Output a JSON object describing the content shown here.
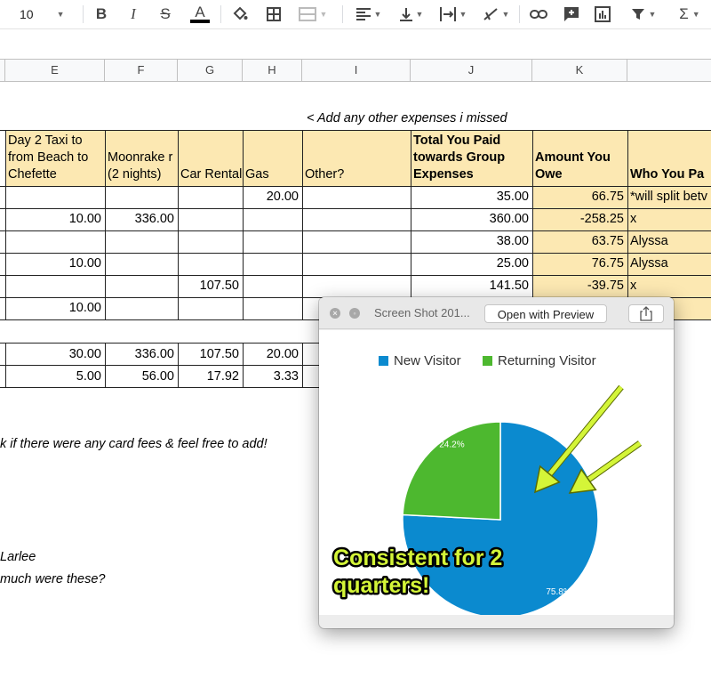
{
  "toolbar": {
    "font_size": "10",
    "bold_label": "B",
    "italic_label": "I",
    "strike_label": "S",
    "text_color_label": "A",
    "sum_label": "Σ"
  },
  "columns": [
    "E",
    "F",
    "G",
    "H",
    "I",
    "J",
    "K"
  ],
  "note_top": "< Add any other expenses i missed",
  "header_row": {
    "e": "Day 2 Taxi to from Beach to Chefette",
    "f": "Moonrake r (2 nights)",
    "g": "Car Rental",
    "h": "Gas",
    "i": "Other?",
    "j": "Total You Paid towards Group Expenses",
    "k": "Amount You Owe",
    "l": "Who You Pa"
  },
  "rows": [
    {
      "e": "",
      "f": "",
      "g": "",
      "h": "20.00",
      "i": "",
      "j": "35.00",
      "k": "66.75",
      "l": "*will split betv"
    },
    {
      "e": "10.00",
      "f": "336.00",
      "g": "",
      "h": "",
      "i": "",
      "j": "360.00",
      "k": "-258.25",
      "l": "x"
    },
    {
      "e": "",
      "f": "",
      "g": "",
      "h": "",
      "i": "",
      "j": "38.00",
      "k": "63.75",
      "l": "Alyssa"
    },
    {
      "e": "10.00",
      "f": "",
      "g": "",
      "h": "",
      "i": "",
      "j": "25.00",
      "k": "76.75",
      "l": "Alyssa"
    },
    {
      "e": "",
      "f": "",
      "g": "107.50",
      "h": "",
      "i": "",
      "j": "141.50",
      "k": "-39.75",
      "l": "x"
    },
    {
      "e": "10.00",
      "f": "",
      "g": "",
      "h": "",
      "i": "",
      "j": "",
      "k": "",
      "l": ""
    }
  ],
  "totals_row": {
    "e": "30.00",
    "f": "336.00",
    "g": "107.50",
    "h": "20.00"
  },
  "per_person_row": {
    "e": "5.00",
    "f": "56.00",
    "g": "17.92",
    "h": "3.33"
  },
  "note_fees": "k if there were any card fees & feel free to add!",
  "note_larlee": "Larlee",
  "note_much": "much were these?",
  "quicklook": {
    "title": "Screen Shot 201...",
    "open_button": "Open with Preview",
    "annotation_line1": "Consistent for 2",
    "annotation_line2": "quarters!"
  },
  "chart_data": {
    "type": "pie",
    "series": [
      {
        "name": "New Visitor",
        "value": 75.8,
        "label": "75.8%",
        "color": "#0b8acf"
      },
      {
        "name": "Returning Visitor",
        "value": 24.2,
        "label": "24.2%",
        "color": "#4db82f"
      }
    ],
    "legend_position": "top"
  },
  "colors": {
    "tan": "#fce8b2",
    "annotation": "#d4f538"
  }
}
